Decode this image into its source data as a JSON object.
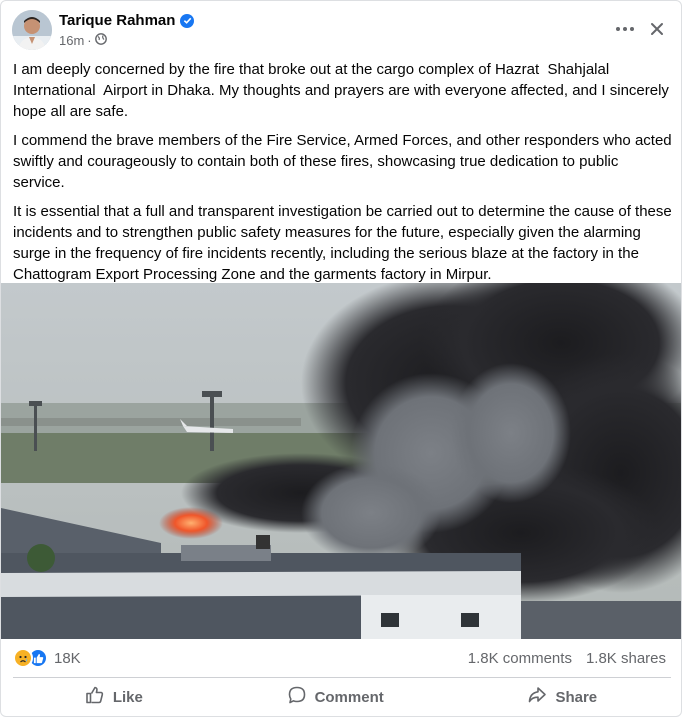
{
  "post": {
    "author": "Tarique Rahman",
    "time": "16m",
    "time_separator": "·",
    "paragraphs": [
      "I am deeply concerned by the fire that broke out at the cargo complex of Hazrat  Shahjalal International  Airport in Dhaka. My thoughts and prayers are with everyone affected, and I sincerely hope all are safe.",
      "I commend the brave members of the Fire Service, Armed Forces, and other responders who acted swiftly and courageously to contain both of these fires, showcasing true dedication to public service.",
      "It is essential that a full and transparent investigation be carried out to determine the cause of these incidents and to strengthen public safety measures for the future, especially given the alarming surge in the frequency of fire incidents recently, including the serious blaze at the factory in the Chattogram Export Processing Zone and the garments factory in Mirpur."
    ]
  },
  "stats": {
    "reaction_count": "18K",
    "comments": "1.8K comments",
    "shares": "1.8K shares"
  },
  "actions": {
    "like": "Like",
    "comment": "Comment",
    "share": "Share"
  },
  "icons": {
    "verified": "verified-badge-icon",
    "privacy": "globe-icon",
    "more": "more-options-icon",
    "close": "close-icon",
    "reaction_sad": "sad-reaction-icon",
    "reaction_like": "like-reaction-icon",
    "like": "thumbs-up-icon",
    "comment": "speech-bubble-icon",
    "share": "share-arrow-icon"
  },
  "colors": {
    "brand": "#1877f2",
    "text": "#050505",
    "muted": "#65676b",
    "sad_reaction": "#f7b125"
  }
}
